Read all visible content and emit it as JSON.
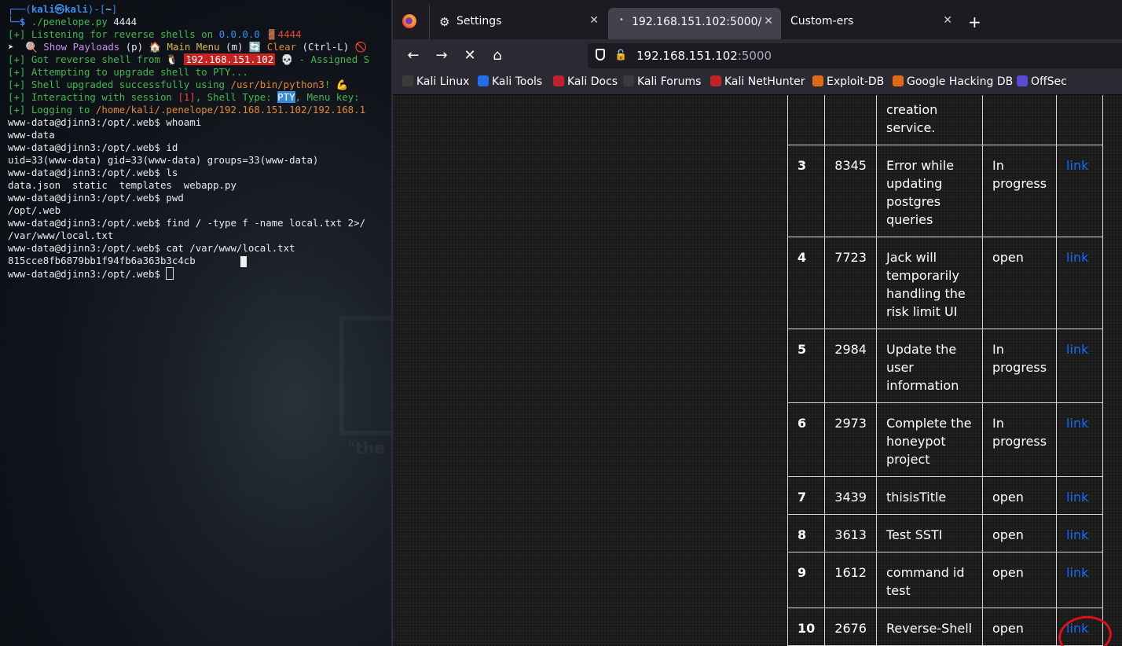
{
  "terminal": {
    "lines": [
      {
        "segs": [
          {
            "t": "┌──(",
            "c": "c-frame"
          },
          {
            "t": "kali㉿kali",
            "c": "c-kali"
          },
          {
            "t": ")-[",
            "c": "c-frame"
          },
          {
            "t": "~",
            "c": "c-white"
          },
          {
            "t": "]",
            "c": "c-frame"
          }
        ]
      },
      {
        "segs": [
          {
            "t": "└─",
            "c": "c-frame"
          },
          {
            "t": "$ ",
            "c": "c-kali"
          },
          {
            "t": "./penelope.py",
            "c": "c-green"
          },
          {
            "t": " 4444",
            "c": "c-white"
          }
        ]
      },
      {
        "segs": [
          {
            "t": "[+] Listening for reverse shells on ",
            "c": "c-green"
          },
          {
            "t": "0.0.0.0",
            "c": "c-blue"
          },
          {
            "t": " 🚪",
            "c": "c-white"
          },
          {
            "t": "4444",
            "c": "c-red"
          }
        ]
      },
      {
        "segs": [
          {
            "t": "➤  ",
            "c": "c-white"
          },
          {
            "t": "🍭 ",
            "c": "c-white"
          },
          {
            "t": "Show Payloads",
            "c": "c-magenta"
          },
          {
            "t": " (p) 🏠 ",
            "c": "c-white"
          },
          {
            "t": "Main Menu",
            "c": "c-yellow"
          },
          {
            "t": " (m) 🔄 ",
            "c": "c-white"
          },
          {
            "t": "Clear",
            "c": "c-orange"
          },
          {
            "t": " (Ctrl-L) 🚫",
            "c": "c-white"
          }
        ]
      },
      {
        "segs": [
          {
            "t": "[+] Got reverse shell from ",
            "c": "c-green"
          },
          {
            "t": "🐧 ",
            "c": "c-white"
          },
          {
            "t": "192.168.151.102",
            "c": "hl-red"
          },
          {
            "t": " 💀 - Assigned S",
            "c": "c-green"
          }
        ]
      },
      {
        "segs": [
          {
            "t": "[+] Attempting to upgrade shell to PTY...",
            "c": "c-green"
          }
        ]
      },
      {
        "segs": [
          {
            "t": "[+] Shell upgraded successfully using ",
            "c": "c-green"
          },
          {
            "t": "/usr/bin/python3",
            "c": "c-orange"
          },
          {
            "t": "! 💪",
            "c": "c-green"
          }
        ]
      },
      {
        "segs": [
          {
            "t": "[+] Interacting with session ",
            "c": "c-green"
          },
          {
            "t": "[1]",
            "c": "c-red"
          },
          {
            "t": ", Shell Type: ",
            "c": "c-green"
          },
          {
            "t": "PTY",
            "c": "hl-blue"
          },
          {
            "t": ", Menu key:",
            "c": "c-green"
          }
        ]
      },
      {
        "segs": [
          {
            "t": "[+] Logging to ",
            "c": "c-green"
          },
          {
            "t": "/home/kali/.penelope/192.168.151.102/192.168.1",
            "c": "c-orange"
          }
        ]
      },
      {
        "segs": [
          {
            "t": "www-data@djinn3:/opt/.web$ whoami",
            "c": "c-white"
          }
        ]
      },
      {
        "segs": [
          {
            "t": "www-data",
            "c": "c-white"
          }
        ]
      },
      {
        "segs": [
          {
            "t": "www-data@djinn3:/opt/.web$ id",
            "c": "c-white"
          }
        ]
      },
      {
        "segs": [
          {
            "t": "uid=33(www-data) gid=33(www-data) groups=33(www-data)",
            "c": "c-white"
          }
        ]
      },
      {
        "segs": [
          {
            "t": "www-data@djinn3:/opt/.web$ ls",
            "c": "c-white"
          }
        ]
      },
      {
        "segs": [
          {
            "t": "data.json  static  templates  webapp.py",
            "c": "c-white"
          }
        ]
      },
      {
        "segs": [
          {
            "t": "www-data@djinn3:/opt/.web$ pwd",
            "c": "c-white"
          }
        ]
      },
      {
        "segs": [
          {
            "t": "/opt/.web",
            "c": "c-white"
          }
        ]
      },
      {
        "segs": [
          {
            "t": "www-data@djinn3:/opt/.web$ find / -type f -name local.txt 2>/",
            "c": "c-white"
          }
        ]
      },
      {
        "segs": [
          {
            "t": "/var/www/local.txt",
            "c": "c-white"
          }
        ]
      },
      {
        "segs": [
          {
            "t": "www-data@djinn3:/opt/.web$ cat /var/www/local.txt",
            "c": "c-white"
          }
        ]
      },
      {
        "segs": [
          {
            "t": "815cce8fb6879bb1f94fb6a363b3c4cb",
            "c": "c-white"
          }
        ]
      },
      {
        "segs": [
          {
            "t": "www-data@djinn3:/opt/.web$ ",
            "c": "c-white"
          }
        ],
        "cursor": true
      }
    ]
  },
  "browser": {
    "tabs": [
      {
        "label": "Settings",
        "close": "✕"
      },
      {
        "label": "192.168.151.102:5000/",
        "close": "✕"
      },
      {
        "label": "Custom-ers",
        "close": "✕"
      }
    ],
    "new_tab": "+",
    "url_host": "192.168.151.102",
    "url_port": ":5000",
    "bookmarks": [
      {
        "label": "Kali Linux",
        "color": "#3b3b3b"
      },
      {
        "label": "Kali Tools",
        "color": "#1f6feb"
      },
      {
        "label": "Kali Docs",
        "color": "#c0232b"
      },
      {
        "label": "Kali Forums",
        "color": "#3b3b3b"
      },
      {
        "label": "Kali NetHunter",
        "color": "#c0232b"
      },
      {
        "label": "Exploit-DB",
        "color": "#e06a1b"
      },
      {
        "label": "Google Hacking DB",
        "color": "#e06a1b"
      },
      {
        "label": "OffSec",
        "color": "#5a4bd6"
      }
    ]
  },
  "table": {
    "rows": [
      {
        "no": "",
        "id": "",
        "title": "creation service.",
        "status": "",
        "link": ""
      },
      {
        "no": "3",
        "id": "8345",
        "title": "Error while updating postgres queries",
        "status": "In progress",
        "link": "link"
      },
      {
        "no": "4",
        "id": "7723",
        "title": "Jack will temporarily handling the risk limit UI",
        "status": "open",
        "link": "link"
      },
      {
        "no": "5",
        "id": "2984",
        "title": "Update the user information",
        "status": "In progress",
        "link": "link"
      },
      {
        "no": "6",
        "id": "2973",
        "title": "Complete the honeypot project",
        "status": "In progress",
        "link": "link"
      },
      {
        "no": "7",
        "id": "3439",
        "title": "thisisTitle",
        "status": "open",
        "link": "link"
      },
      {
        "no": "8",
        "id": "3613",
        "title": "Test SSTI",
        "status": "open",
        "link": "link"
      },
      {
        "no": "9",
        "id": "1612",
        "title": "command id test",
        "status": "open",
        "link": "link"
      },
      {
        "no": "10",
        "id": "2676",
        "title": "Reverse-Shell",
        "status": "open",
        "link": "link"
      }
    ]
  }
}
